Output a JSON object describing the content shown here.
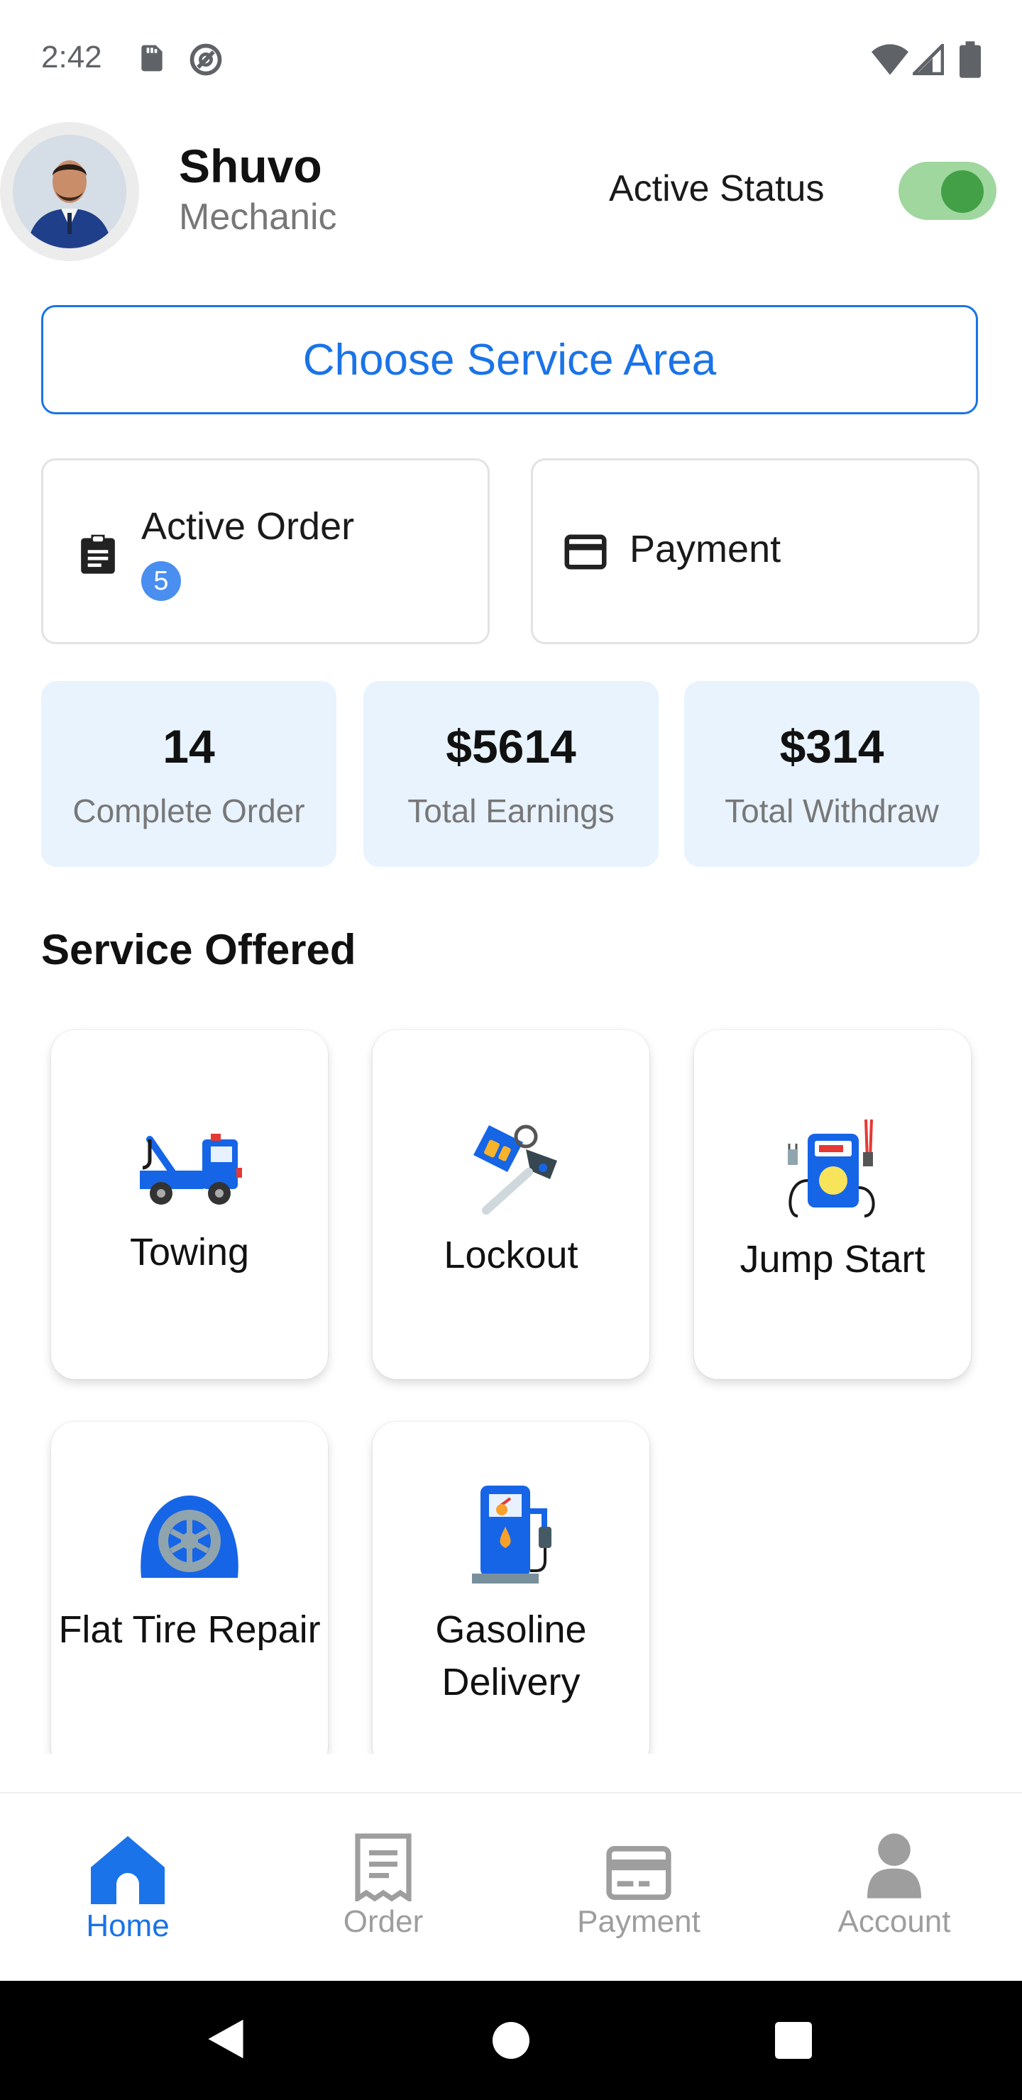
{
  "status_bar": {
    "time": "2:42"
  },
  "header": {
    "name": "Shuvo",
    "role": "Mechanic",
    "active_status_label": "Active Status",
    "active_status_on": true
  },
  "choose_area_label": "Choose Service Area",
  "quick_actions": [
    {
      "label": "Active Order",
      "badge": "5",
      "icon": "clipboard-icon"
    },
    {
      "label": "Payment",
      "icon": "credit-card-icon"
    }
  ],
  "stats": [
    {
      "value": "14",
      "label": "Complete Order"
    },
    {
      "value": "$5614",
      "label": "Total Earnings"
    },
    {
      "value": "$314",
      "label": "Total Withdraw"
    }
  ],
  "section_title": "Service Offered",
  "services": [
    {
      "label": "Towing",
      "icon": "tow-truck-icon"
    },
    {
      "label": "Lockout",
      "icon": "car-key-icon"
    },
    {
      "label": "Jump Start",
      "icon": "battery-charger-icon"
    },
    {
      "label": "Flat Tire Repair",
      "icon": "tire-icon"
    },
    {
      "label": "Gasoline Delivery",
      "icon": "fuel-pump-icon"
    }
  ],
  "bottom_nav": [
    {
      "label": "Home",
      "icon": "home-icon",
      "active": true
    },
    {
      "label": "Order",
      "icon": "receipt-icon",
      "active": false
    },
    {
      "label": "Payment",
      "icon": "card-icon",
      "active": false
    },
    {
      "label": "Account",
      "icon": "person-icon",
      "active": false
    }
  ],
  "colors": {
    "accent": "#1a73e8",
    "toggle_on": "#43a047",
    "stat_bg": "#e8f3fe",
    "icon_blue": "#1565e6"
  }
}
